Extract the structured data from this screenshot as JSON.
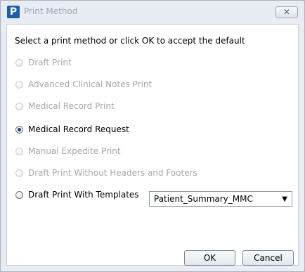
{
  "window": {
    "title": "Print Method",
    "app_icon_letter": "P",
    "close_glyph": "✕"
  },
  "prompt": "Select a print method or click OK to accept the default",
  "options": [
    {
      "label": "Draft Print",
      "enabled": false,
      "checked": false
    },
    {
      "label": "Advanced Clinical Notes Print",
      "enabled": false,
      "checked": false
    },
    {
      "label": "Medical Record Print",
      "enabled": false,
      "checked": false
    },
    {
      "label": "Medical Record Request",
      "enabled": true,
      "checked": true
    },
    {
      "label": "Manual Expedite Print",
      "enabled": false,
      "checked": false
    },
    {
      "label": "Draft Print Without Headers and Footers",
      "enabled": false,
      "checked": false
    },
    {
      "label": "Draft Print With Templates",
      "enabled": true,
      "checked": false
    }
  ],
  "template_select": {
    "value": "Patient_Summary_MMC",
    "arrow_icon": "▼"
  },
  "buttons": {
    "ok": "OK",
    "cancel": "Cancel"
  }
}
